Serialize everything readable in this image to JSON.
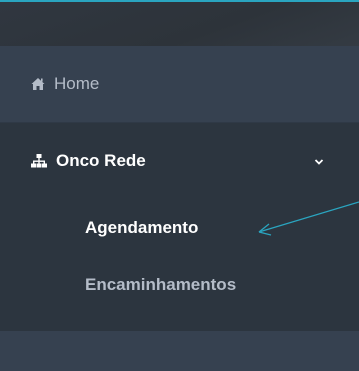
{
  "sidebar": {
    "home": {
      "label": "Home",
      "icon": "home-icon"
    },
    "onco_rede": {
      "label": "Onco Rede",
      "icon": "sitemap-icon",
      "expanded": true,
      "items": [
        {
          "label": "Agendamento",
          "active": true
        },
        {
          "label": "Encaminhamentos",
          "active": false
        }
      ]
    }
  },
  "colors": {
    "accent": "#2aa5c0",
    "sidebar_bg": "#364150",
    "submenu_bg": "#2c353f",
    "text_muted": "#b4bcc8",
    "text_active": "#ffffff"
  }
}
